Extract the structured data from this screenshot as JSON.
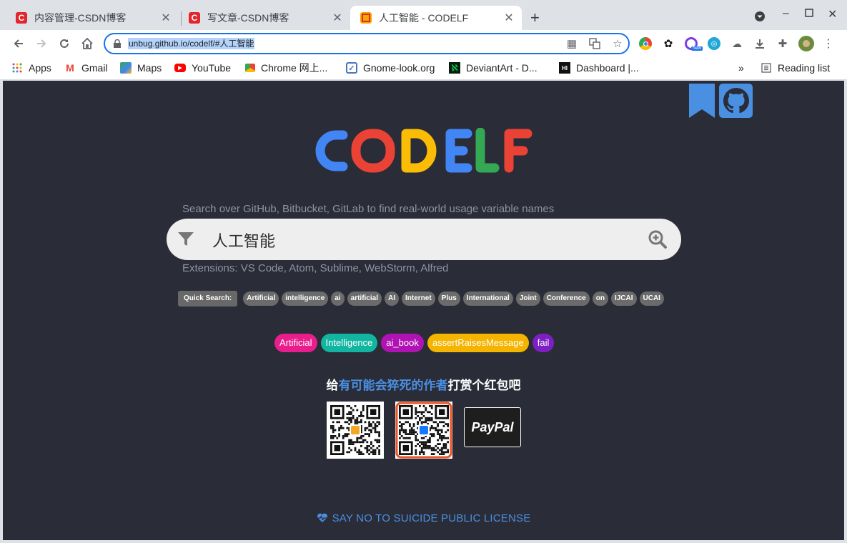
{
  "tabs": [
    {
      "title": "内容管理-CSDN博客",
      "favicon": "csdn-icon",
      "active": false
    },
    {
      "title": "写文章-CSDN博客",
      "favicon": "csdn-icon",
      "active": false
    },
    {
      "title": "人工智能  -  CODELF",
      "favicon": "codelf-icon",
      "active": true
    }
  ],
  "omnibox": {
    "url": "unbug.github.io/codelf/#人工智能"
  },
  "bookmarks": [
    {
      "label": "Apps",
      "icon": "apps-grid-icon"
    },
    {
      "label": "Gmail",
      "icon": "gmail-icon"
    },
    {
      "label": "Maps",
      "icon": "maps-icon"
    },
    {
      "label": "YouTube",
      "icon": "youtube-icon"
    },
    {
      "label": "Chrome 网上...",
      "icon": "chrome-store-icon"
    },
    {
      "label": "Gnome-look.org",
      "icon": "gnome-look-icon"
    },
    {
      "label": "DeviantArt - D...",
      "icon": "deviantart-icon"
    },
    {
      "label": "Dashboard |...",
      "icon": "dashboard-icon"
    }
  ],
  "reading_list": "Reading list",
  "overflow": "»",
  "page": {
    "logo_text": "CODELF",
    "logo_colors": [
      "#4285f4",
      "#ea4335",
      "#fbbc05",
      "#4285f4",
      "#ea4335",
      "#34a853",
      "#ea4335"
    ],
    "hint_top": "Search over GitHub, Bitbucket, GitLab to find real-world usage variable names",
    "query": "人工智能",
    "hint_bottom": "Extensions: VS Code, Atom, Sublime, WebStorm, Alfred",
    "quick_search_label": "Quick Search:",
    "quick_tags": [
      "Artificial",
      "intelligence",
      "ai",
      "artificial",
      "AI",
      "Internet",
      "Plus",
      "International",
      "Joint",
      "Conference",
      "on",
      "IJCAI",
      "UCAI"
    ],
    "related_tags": [
      {
        "label": "Artificial",
        "color": "#e91e8c"
      },
      {
        "label": "Intelligence",
        "color": "#11b5a0"
      },
      {
        "label": "ai_book",
        "color": "#b012b4"
      },
      {
        "label": "assertRaisesMessage",
        "color": "#f5b400"
      },
      {
        "label": "fail",
        "color": "#7e1fc4"
      }
    ],
    "donate_prefix": "给",
    "donate_highlight": "有可能会猝死的作者",
    "donate_suffix": "打赏个红包吧",
    "paypal_label": "PayPal",
    "license": "SAY NO TO SUICIDE PUBLIC LICENSE"
  }
}
